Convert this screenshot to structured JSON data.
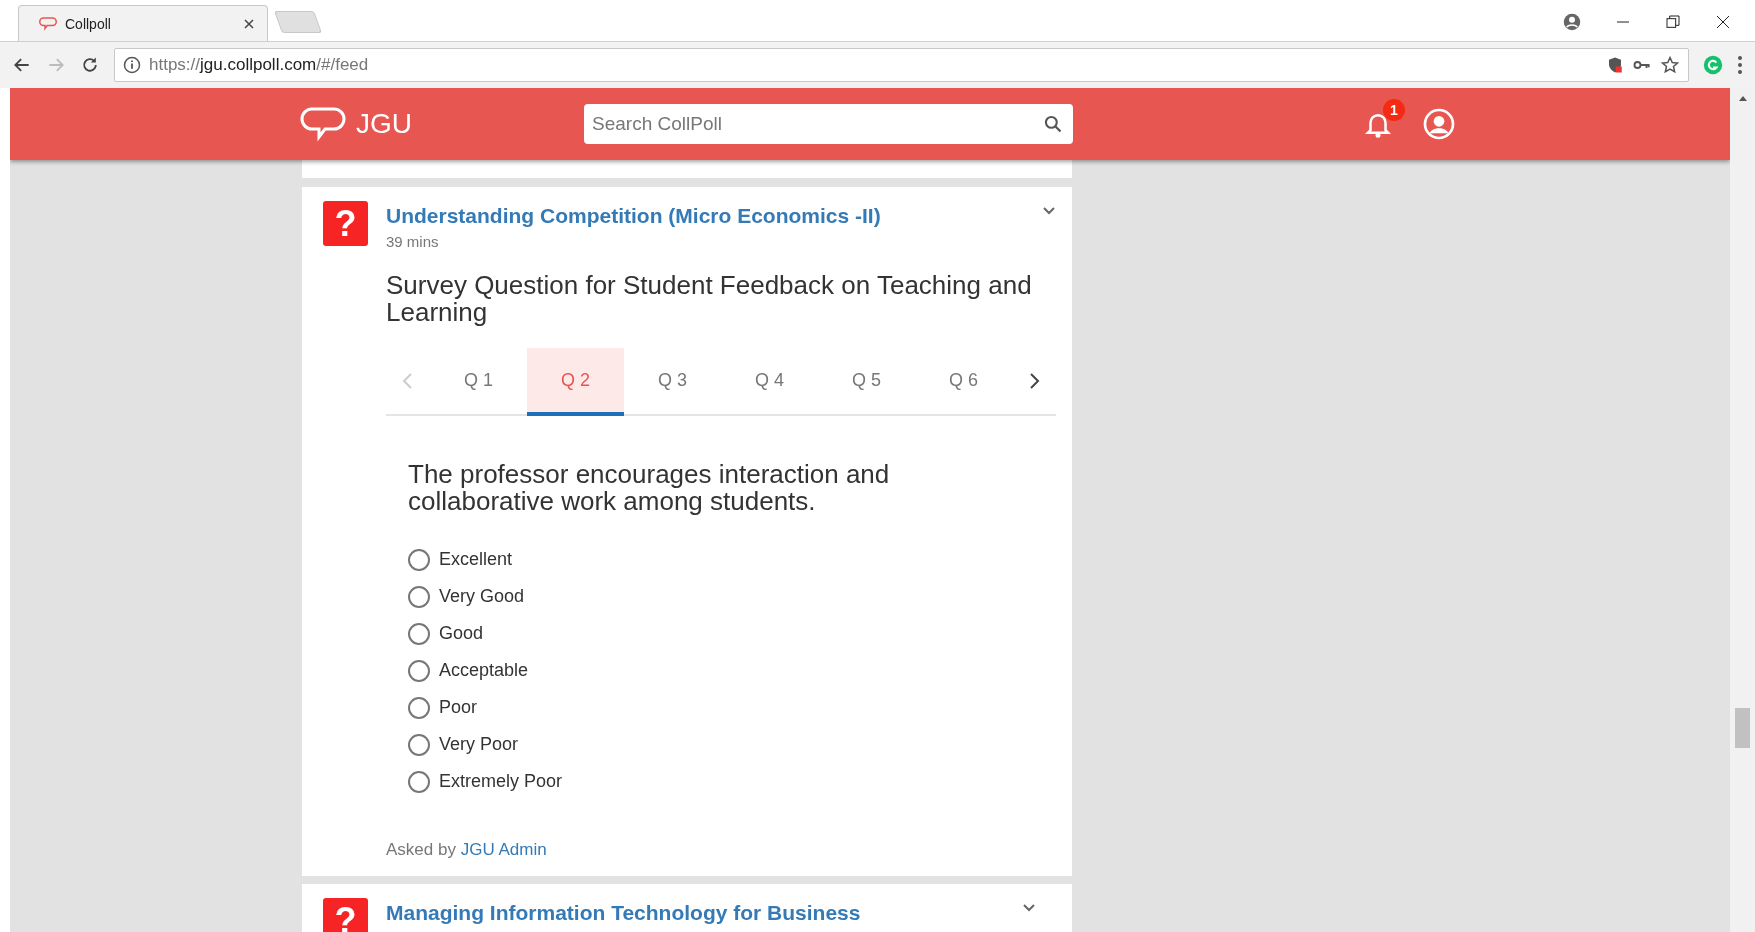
{
  "browser": {
    "tab_title": "Collpoll",
    "url_scheme": "https://",
    "url_host": "jgu.collpoll.com",
    "url_path": "/#/feed"
  },
  "header": {
    "brand": "JGU",
    "search": {
      "placeholder": "Search CollPoll"
    },
    "notification_count": "1"
  },
  "posts": [
    {
      "icon_text": "?",
      "title": "Understanding Competition (Micro Economics -II)",
      "time": "39 mins",
      "survey_title": "Survey Question for Student Feedback on Teaching and Learning",
      "prev_disabled": true,
      "tabs": [
        {
          "label": "Q 1",
          "selected": false
        },
        {
          "label": "Q 2",
          "selected": true
        },
        {
          "label": "Q 3",
          "selected": false
        },
        {
          "label": "Q 4",
          "selected": false
        },
        {
          "label": "Q 5",
          "selected": false
        },
        {
          "label": "Q 6",
          "selected": false
        }
      ],
      "question": "The professor encourages interaction and collaborative work among students.",
      "options": [
        {
          "label": "Excellent",
          "selected": false
        },
        {
          "label": "Very Good",
          "selected": false
        },
        {
          "label": "Good",
          "selected": false
        },
        {
          "label": "Acceptable",
          "selected": false
        },
        {
          "label": "Poor",
          "selected": false
        },
        {
          "label": "Very Poor",
          "selected": false
        },
        {
          "label": "Extremely Poor",
          "selected": false
        }
      ],
      "asked_by_prefix": "Asked by",
      "asked_by": "JGU Admin"
    },
    {
      "icon_text": "?",
      "title": "Managing Information Technology for Business"
    }
  ]
}
